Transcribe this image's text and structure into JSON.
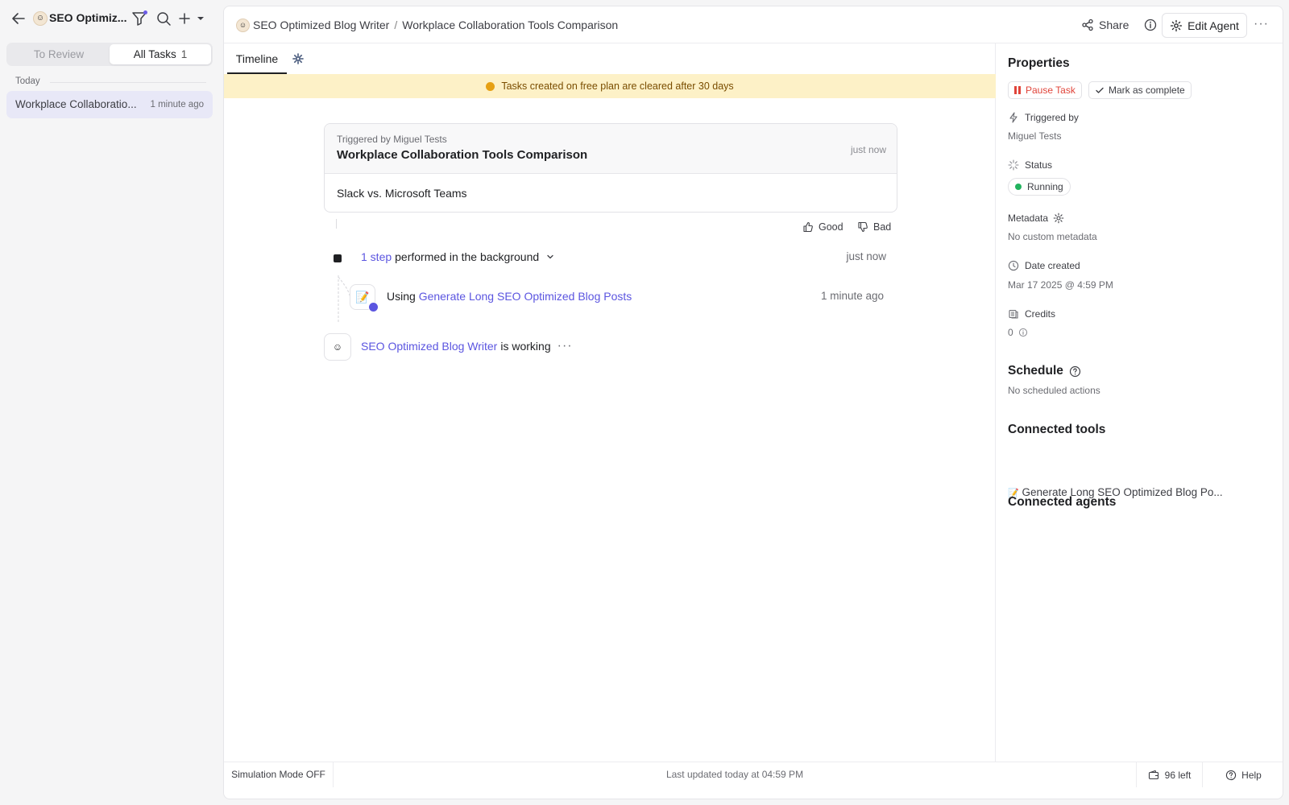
{
  "sidebar": {
    "agent_title": "SEO Optimiz...",
    "tabs": [
      {
        "label": "To Review",
        "count": ""
      },
      {
        "label": "All Tasks",
        "count": "1"
      }
    ],
    "group_label": "Today",
    "tasks": [
      {
        "name": "Workplace Collaboratio...",
        "time": "1 minute ago"
      }
    ]
  },
  "breadcrumb": {
    "agent": "SEO Optimized Blog Writer",
    "separator": "/",
    "task": "Workplace Collaboration Tools Comparison"
  },
  "toolbar": {
    "share_label": "Share",
    "edit_agent_label": "Edit Agent"
  },
  "tabs": {
    "timeline_label": "Timeline"
  },
  "banner": {
    "text": "Tasks created on free plan are cleared after 30 days"
  },
  "task_card": {
    "triggered_by": "Triggered by Miguel Tests",
    "title": "Workplace Collaboration Tools Comparison",
    "time": "just now",
    "body": "Slack vs. Microsoft Teams"
  },
  "feedback": {
    "good_label": "Good",
    "bad_label": "Bad"
  },
  "steps": {
    "count_link": "1 step",
    "text": "performed in the background",
    "time": "just now",
    "tool_prefix": "Using",
    "tool_name": "Generate Long SEO Optimized Blog Posts",
    "tool_time": "1 minute ago"
  },
  "working": {
    "agent_link": "SEO Optimized Blog Writer",
    "text": "is working"
  },
  "properties": {
    "heading": "Properties",
    "pause_label": "Pause Task",
    "complete_label": "Mark as complete",
    "triggered_label": "Triggered by",
    "triggered_value": "Miguel Tests",
    "status_label": "Status",
    "status_value": "Running",
    "metadata_label": "Metadata",
    "metadata_value": "No custom metadata",
    "date_label": "Date created",
    "date_value": "Mar 17 2025 @ 4:59 PM",
    "credits_label": "Credits",
    "credits_value": "0"
  },
  "schedule": {
    "heading": "Schedule",
    "value": "No scheduled actions"
  },
  "connected_tools": {
    "heading": "Connected tools",
    "items": [
      "Generate Long SEO Optimized Blog Po..."
    ]
  },
  "connected_agents": {
    "heading": "Connected agents"
  },
  "footer": {
    "simulation": "Simulation Mode OFF",
    "updated": "Last updated today at 04:59 PM",
    "left": "96 left",
    "help": "Help"
  },
  "colors": {
    "accent": "#5b55e0",
    "danger": "#e0443a",
    "success": "#22b35e",
    "banner_bg": "#fdf1c7",
    "selected_bg": "#e8e8f7"
  }
}
